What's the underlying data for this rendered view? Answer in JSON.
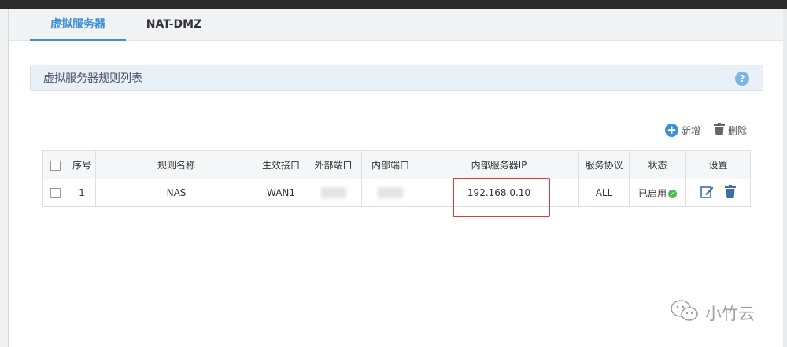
{
  "tabs": [
    {
      "label": "虚拟服务器",
      "active": true
    },
    {
      "label": "NAT-DMZ",
      "active": false
    }
  ],
  "section": {
    "title": "虚拟服务器规则列表",
    "help_glyph": "?"
  },
  "toolbar": {
    "add_label": "新增",
    "delete_label": "删除",
    "add_glyph": "+"
  },
  "table": {
    "columns": [
      "序号",
      "规则名称",
      "生效接口",
      "外部端口",
      "内部端口",
      "内部服务器IP",
      "服务协议",
      "状态",
      "设置"
    ],
    "rows": [
      {
        "index": "1",
        "name": "NAS",
        "interface": "WAN1",
        "internal_ip": "192.168.0.10",
        "protocol": "ALL",
        "status": "已启用"
      }
    ]
  },
  "watermark": {
    "text": "小竹云"
  },
  "colors": {
    "accent": "#3d8fd8",
    "highlight": "#e23a3a",
    "status_ok": "#4cba59"
  }
}
